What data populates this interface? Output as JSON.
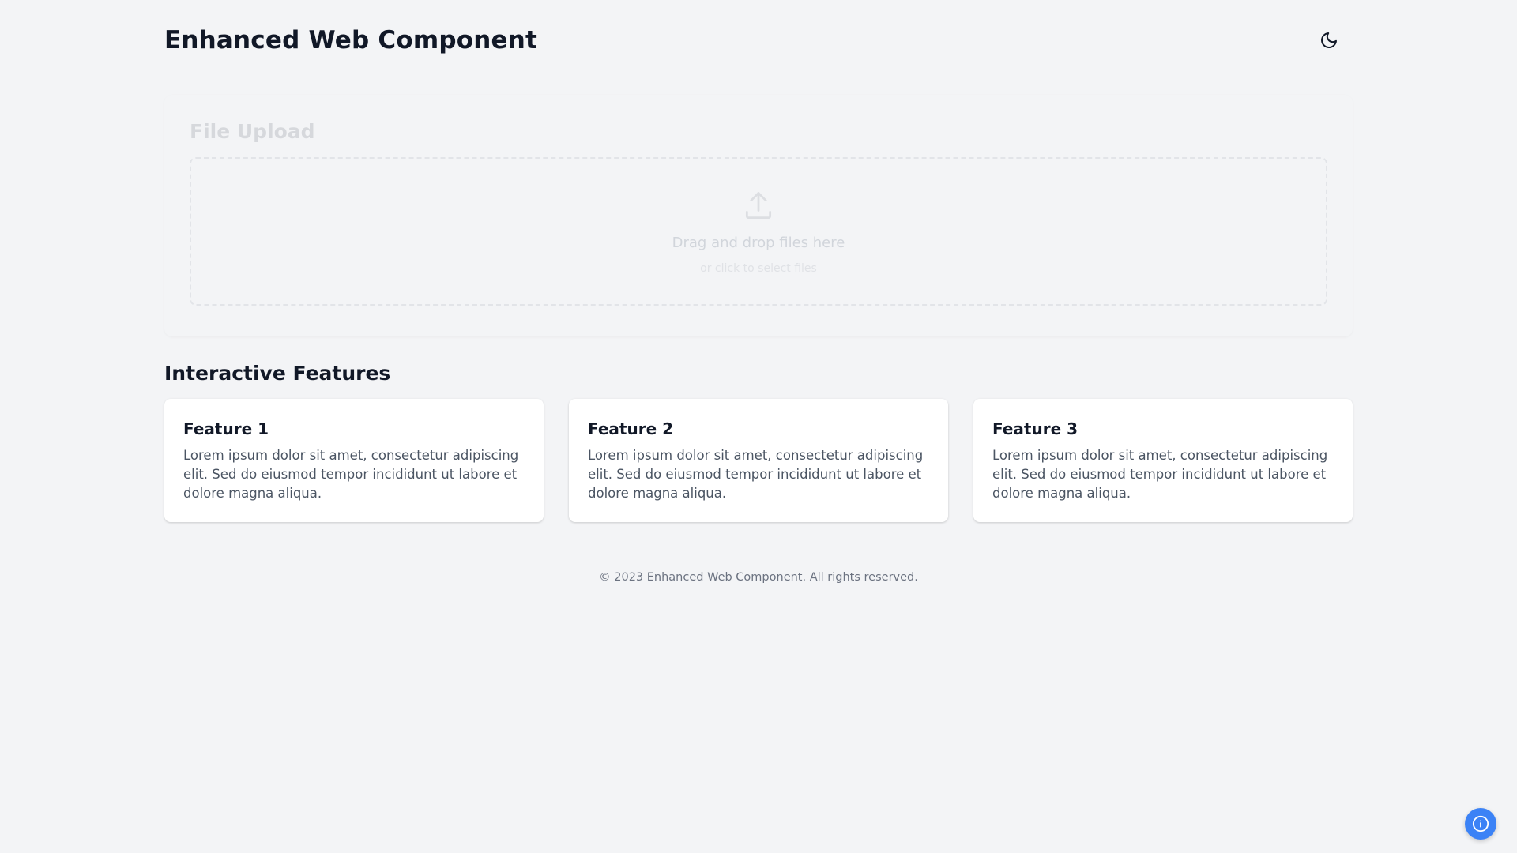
{
  "header": {
    "title": "Enhanced Web Component",
    "theme_toggle_icon": "moon-icon"
  },
  "upload": {
    "title": "File Upload",
    "icon": "upload-icon",
    "drop_text": "Drag and drop files here",
    "sub_text": "or click to select files"
  },
  "features": {
    "title": "Interactive Features",
    "items": [
      {
        "title": "Feature 1",
        "text": "Lorem ipsum dolor sit amet, consectetur adipiscing elit. Sed do eiusmod tempor incididunt ut labore et dolore magna aliqua."
      },
      {
        "title": "Feature 2",
        "text": "Lorem ipsum dolor sit amet, consectetur adipiscing elit. Sed do eiusmod tempor incididunt ut labore et dolore magna aliqua."
      },
      {
        "title": "Feature 3",
        "text": "Lorem ipsum dolor sit amet, consectetur adipiscing elit. Sed do eiusmod tempor incididunt ut labore et dolore magna aliqua."
      }
    ]
  },
  "footer": {
    "text": "© 2023 Enhanced Web Component. All rights reserved."
  },
  "floating": {
    "icon": "info-icon"
  },
  "colors": {
    "background": "#f3f4f6",
    "accent": "#3b82f6",
    "text": "#111827"
  }
}
